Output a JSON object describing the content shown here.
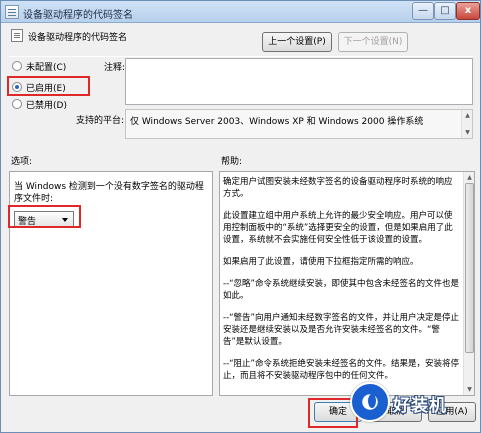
{
  "window": {
    "title": "设备驱动程序的代码签名",
    "controls": {
      "minimize": "—",
      "maximize": "□",
      "close": "x"
    }
  },
  "header": {
    "title": "设备驱动程序的代码签名",
    "prev_button": "上一个设置(P)",
    "next_button": "下一个设置(N)"
  },
  "state": {
    "options": [
      {
        "label": "未配置(C)",
        "selected": false
      },
      {
        "label": "已启用(E)",
        "selected": true
      },
      {
        "label": "已禁用(D)",
        "selected": false
      }
    ]
  },
  "comment": {
    "label": "注释:",
    "value": ""
  },
  "platform": {
    "label": "支持的平台:",
    "value": "仅 Windows Server 2003、Windows XP 和 Windows 2000 操作系统"
  },
  "options_section": {
    "label": "选项:",
    "description": "当 Windows 检测到一个没有数字签名的驱动程序文件时:",
    "dropdown_value": "警告"
  },
  "help_section": {
    "label": "帮助:",
    "paragraphs": [
      "确定用户试图安装未经数字签名的设备驱动程序时系统的响应方式。",
      "此设置建立组中用户系统上允许的最少安全响应。用户可以使用控制面板中的“系统”选择更安全的设置，但是如果启用了此设置，系统就不会实施任何安全性低于该设置的设置。",
      "如果启用了此设置，请使用下拉框指定所需的响应。",
      "--“忽略”命令系统继续安装，即使其中包含未经签名的文件也是如此。",
      "--“警告”向用户通知未经数字签名的文件，并让用户决定是停止安装还是继续安装以及是否允许安装未经签名的文件。“警告”是默认设置。",
      "--“阻止”命令系统拒绝安装未经签名的文件。结果是，安装将停止，而且将不安装驱动程序包中的任何文件。"
    ]
  },
  "footer": {
    "ok_button": "确定",
    "cancel_button": "取消",
    "apply_button": "应用(A)"
  },
  "watermark": {
    "text": "好装机"
  },
  "colors": {
    "highlight_red": "#e0282b",
    "radio_dot": "#2a6bb8"
  }
}
